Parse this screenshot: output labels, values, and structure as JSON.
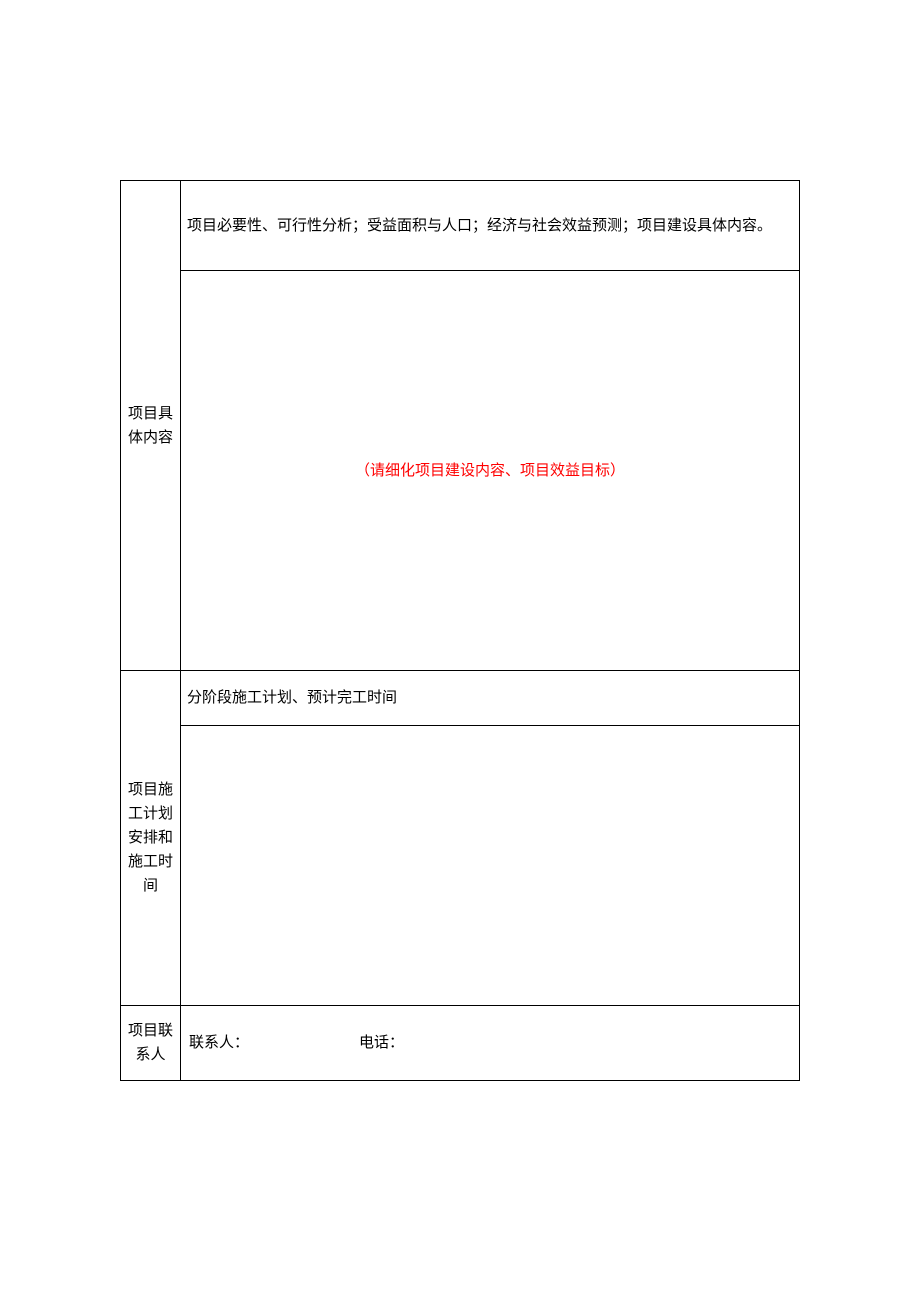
{
  "rows": {
    "section1": {
      "label": "项目具体内容",
      "description": "项目必要性、可行性分析；受益面积与人口；经济与社会效益预测；项目建设具体内容。",
      "hint": "（请细化项目建设内容、项目效益目标）"
    },
    "section2": {
      "label": "项目施工计划安排和施工时间",
      "description": "分阶段施工计划、预计完工时间"
    },
    "section3": {
      "label": "项目联系人",
      "contact_label": "联系人：",
      "phone_label": "电话："
    }
  }
}
